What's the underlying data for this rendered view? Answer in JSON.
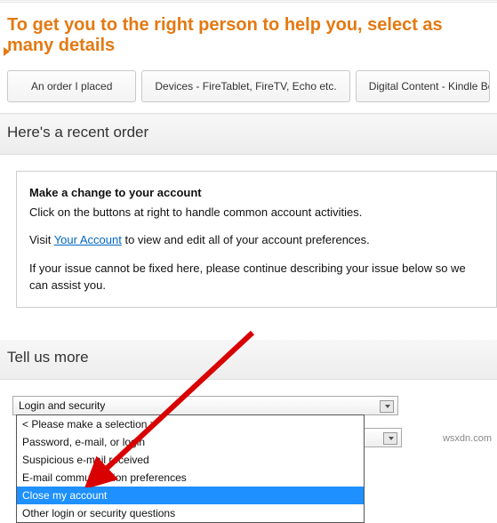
{
  "heading": "To get you to the right person to help you, select as many details",
  "tabs": [
    "An order I placed",
    "Devices - FireTablet, FireTV, Echo etc.",
    "Digital Content - Kindle Books, Videos, Music e"
  ],
  "recent_order": {
    "header": "Here's a recent order",
    "box_title": "Make a change to your account",
    "line1": "Click on the buttons at right to handle common account activities.",
    "line2_a": "Visit ",
    "line2_link": "Your Account",
    "line2_b": " to view and edit all of your account preferences.",
    "line3": "If your issue cannot be fixed here, please continue describing your issue below so we can assist you."
  },
  "tell_us": {
    "header": "Tell us more",
    "select1": "Login and security",
    "select2": "< Please make a selection >",
    "options": [
      "< Please make a selection >",
      "Password, e-mail, or login",
      "Suspicious e-mail received",
      "E-mail communication preferences",
      "Close my account",
      "Other login or security questions"
    ]
  },
  "watermark": "wsxdn.com"
}
